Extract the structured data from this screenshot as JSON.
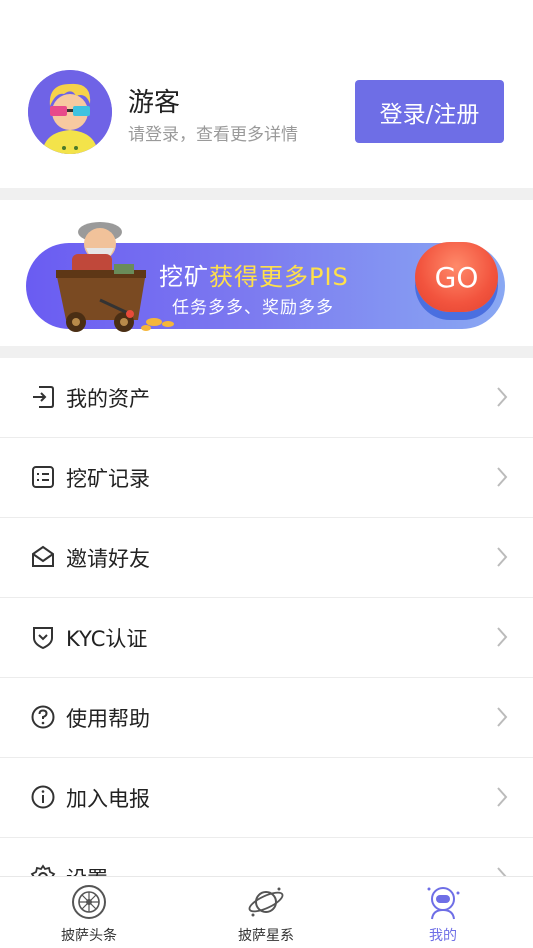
{
  "profile": {
    "username": "游客",
    "subtitle": "请登录，查看更多详情",
    "login_button": "登录/注册"
  },
  "banner": {
    "title_prefix": "挖矿",
    "title_highlight": "获得更多PIS",
    "subtitle": "任务多多、奖励多多",
    "go_label": "GO"
  },
  "menu": {
    "items": [
      {
        "label": "我的资产",
        "icon": "asset-login-icon"
      },
      {
        "label": "挖矿记录",
        "icon": "list-icon"
      },
      {
        "label": "邀请好友",
        "icon": "envelope-icon"
      },
      {
        "label": "KYC认证",
        "icon": "shield-check-icon"
      },
      {
        "label": "使用帮助",
        "icon": "help-circle-icon"
      },
      {
        "label": "加入电报",
        "icon": "info-circle-icon"
      },
      {
        "label": "设置",
        "icon": "gear-icon"
      }
    ]
  },
  "tabbar": {
    "tabs": [
      {
        "label": "披萨头条",
        "icon": "pizza-headline-icon"
      },
      {
        "label": "披萨星系",
        "icon": "planet-icon"
      },
      {
        "label": "我的",
        "icon": "astronaut-icon"
      }
    ],
    "active_index": 2
  },
  "colors": {
    "accent": "#6e6ee6",
    "highlight": "#ffe04a",
    "go_red": "#f2543e"
  }
}
